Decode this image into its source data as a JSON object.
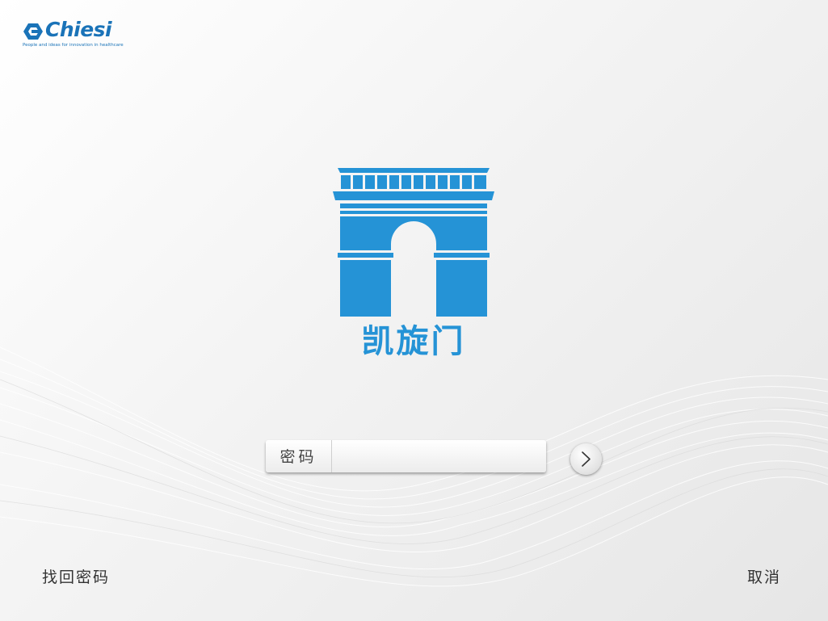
{
  "brand": {
    "name": "Chiesi",
    "tagline": "People and ideas for innovation in healthcare",
    "icon": "chiesi-logo-icon",
    "color": "#1a73b8"
  },
  "app": {
    "logo_icon": "arc-de-triomphe-icon",
    "title": "凯旋门",
    "accent_color": "#2593d6"
  },
  "login": {
    "password_label": "密码",
    "password_value": "",
    "submit_icon": "chevron-right-icon"
  },
  "footer": {
    "forgot_password": "找回密码",
    "cancel": "取消"
  }
}
